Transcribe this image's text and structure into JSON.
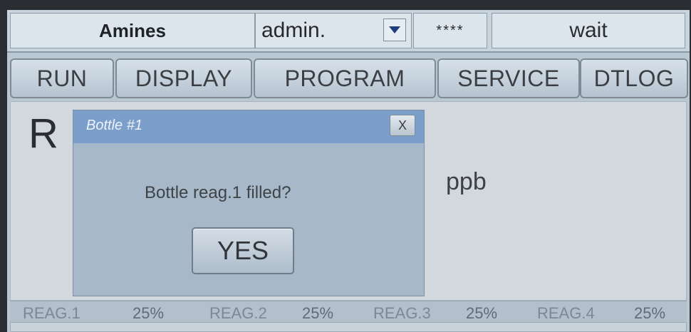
{
  "topbar": {
    "app_name": "Amines",
    "user": "admin.",
    "password_mask": "****",
    "status": "wait"
  },
  "tabs": [
    "RUN",
    "DISPLAY",
    "PROGRAM",
    "SERVICE",
    "DTLOG"
  ],
  "main": {
    "big_letter": "R",
    "unit": "ppb"
  },
  "dialog": {
    "title": "Bottle #1",
    "close_label": "X",
    "message": "Bottle reag.1 filled?",
    "yes_label": "YES"
  },
  "reagents": [
    {
      "label": "REAG.1",
      "percent": "25%"
    },
    {
      "label": "REAG.2",
      "percent": "25%"
    },
    {
      "label": "REAG.3",
      "percent": "25%"
    },
    {
      "label": "REAG.4",
      "percent": "25%"
    }
  ],
  "icons": {
    "dropdown": "chevron-down-icon"
  },
  "colors": {
    "dialog_title_bar": "#7c9ecb",
    "screen_bg": "#b9c7d3"
  }
}
